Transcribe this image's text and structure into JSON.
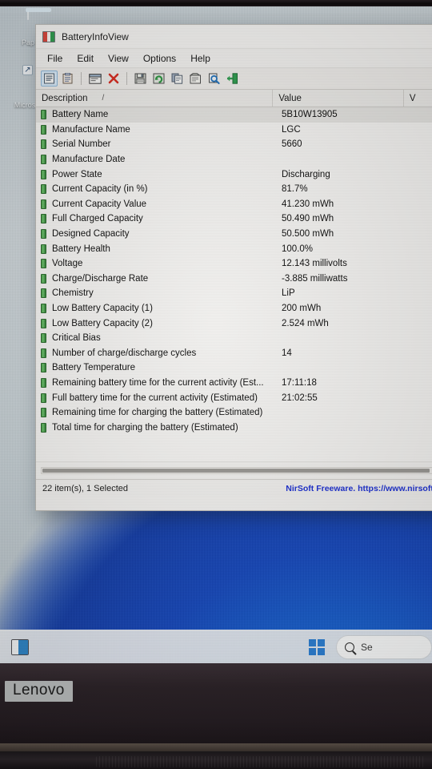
{
  "device": {
    "brand_badge": "Lenovo"
  },
  "desktop": {
    "icons": [
      {
        "name": "recycle-bin",
        "label": "Pap",
        "glyph": "recycle-bin-icon"
      },
      {
        "name": "microsoft-edge",
        "label": "Micros",
        "glyph": "edge-icon"
      }
    ]
  },
  "window": {
    "title": "BatteryInfoView",
    "app_icon": "battery-icon",
    "minimize_label": "–",
    "menu": [
      {
        "label": "File"
      },
      {
        "label": "Edit"
      },
      {
        "label": "View"
      },
      {
        "label": "Options"
      },
      {
        "label": "Help"
      }
    ],
    "toolbar": [
      {
        "name": "properties-button",
        "icon": "properties-icon",
        "active": true
      },
      {
        "name": "copy-to-clipboard-button",
        "icon": "clipboard-icon",
        "active": false
      },
      {
        "name": "separator-1",
        "icon": "separator",
        "active": false
      },
      {
        "name": "window-button",
        "icon": "window-icon",
        "active": false
      },
      {
        "name": "delete-button",
        "icon": "red-x-icon",
        "active": false
      },
      {
        "name": "separator-2",
        "icon": "separator",
        "active": false
      },
      {
        "name": "save-button",
        "icon": "floppy-disk-icon",
        "active": false
      },
      {
        "name": "refresh-button",
        "icon": "refresh-icon",
        "active": false
      },
      {
        "name": "copy-button",
        "icon": "copy-pages-icon",
        "active": false
      },
      {
        "name": "html-report-button",
        "icon": "html-report-icon",
        "active": false
      },
      {
        "name": "find-button",
        "icon": "find-icon",
        "active": false
      },
      {
        "name": "exit-button",
        "icon": "exit-door-icon",
        "active": false
      }
    ],
    "columns": [
      {
        "label": "Description",
        "sort": "/"
      },
      {
        "label": "Value",
        "sort": ""
      },
      {
        "label": "V",
        "sort": ""
      }
    ],
    "rows": [
      {
        "description": "Battery Name",
        "value": "5B10W13905",
        "selected": true
      },
      {
        "description": "Manufacture Name",
        "value": "LGC",
        "selected": false
      },
      {
        "description": "Serial Number",
        "value": "5660",
        "selected": false
      },
      {
        "description": "Manufacture Date",
        "value": "",
        "selected": false
      },
      {
        "description": "Power State",
        "value": "Discharging",
        "selected": false
      },
      {
        "description": "Current Capacity (in %)",
        "value": "81.7%",
        "selected": false
      },
      {
        "description": "Current Capacity Value",
        "value": "41.230 mWh",
        "selected": false
      },
      {
        "description": "Full Charged Capacity",
        "value": "50.490 mWh",
        "selected": false
      },
      {
        "description": "Designed Capacity",
        "value": "50.500 mWh",
        "selected": false
      },
      {
        "description": "Battery Health",
        "value": "100.0%",
        "selected": false
      },
      {
        "description": "Voltage",
        "value": "12.143 millivolts",
        "selected": false
      },
      {
        "description": "Charge/Discharge Rate",
        "value": "-3.885 milliwatts",
        "selected": false
      },
      {
        "description": "Chemistry",
        "value": "LiP",
        "selected": false
      },
      {
        "description": "Low Battery Capacity (1)",
        "value": "200 mWh",
        "selected": false
      },
      {
        "description": "Low Battery Capacity (2)",
        "value": "2.524 mWh",
        "selected": false
      },
      {
        "description": "Critical Bias",
        "value": "",
        "selected": false
      },
      {
        "description": "Number of charge/discharge cycles",
        "value": "14",
        "selected": false
      },
      {
        "description": "Battery Temperature",
        "value": "",
        "selected": false
      },
      {
        "description": "Remaining battery time for the current activity (Est...",
        "value": "17:11:18",
        "selected": false
      },
      {
        "description": "Full battery time for the current activity (Estimated)",
        "value": "21:02:55",
        "selected": false
      },
      {
        "description": "Remaining time for charging the battery (Estimated)",
        "value": "",
        "selected": false
      },
      {
        "description": "Total  time for charging the battery (Estimated)",
        "value": "",
        "selected": false
      }
    ],
    "status": {
      "left": "22 item(s), 1 Selected",
      "right": "NirSoft Freeware. https://www.nirsoft.ne",
      "right_color": "#1c2fd0"
    }
  },
  "taskbar": {
    "widgets_icon": "widgets-icon",
    "start_icon": "windows-start-icon",
    "search_placeholder": "Se",
    "search_icon": "search-icon"
  }
}
